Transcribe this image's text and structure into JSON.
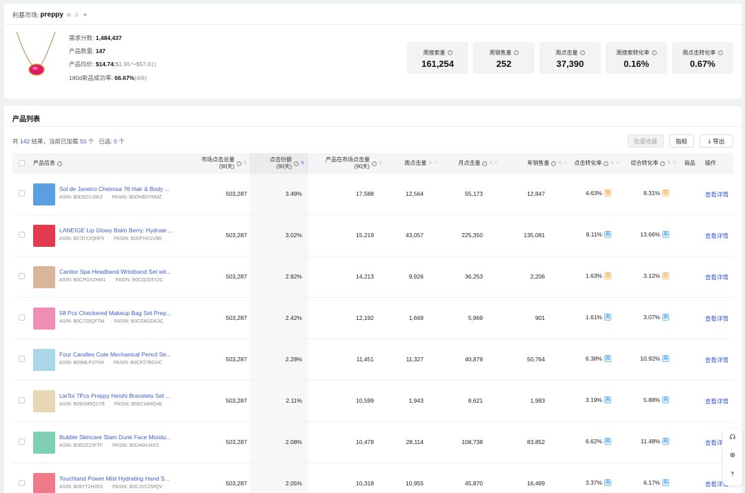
{
  "market": {
    "label": "利基市场:",
    "keyword": "preppy",
    "copy_icon": "copy-icon",
    "share_icon": "person-icon",
    "star_icon": "star-icon"
  },
  "overview": {
    "demand_label": "需求分数:",
    "demand_value": "1,484,437",
    "count_label": "产品数量:",
    "count_value": "147",
    "price_label": "产品均价:",
    "price_value": "$14.74",
    "price_range": "($1.95～$57.61)",
    "success_label": "180d新品成功率:",
    "success_value": "66.67%",
    "success_frac": "(4/6)"
  },
  "stats": [
    {
      "label": "周搜索量",
      "value": "161,254"
    },
    {
      "label": "周销售量",
      "value": "252"
    },
    {
      "label": "周点击量",
      "value": "37,390"
    },
    {
      "label": "周搜索转化率",
      "value": "0.16%"
    },
    {
      "label": "周点击转化率",
      "value": "0.67%"
    }
  ],
  "list": {
    "title": "产品列表",
    "summary_pre": "共",
    "total": "142",
    "summary_mid": "结果，当前已加载",
    "loaded": "50",
    "summary_unit": "个",
    "selected_label": "已选:",
    "selected": "0",
    "batch_label": "批量收藏",
    "metrics_label": "指标",
    "export_label": "导出"
  },
  "columns": {
    "info": "产品信息",
    "market_clicks": "市场点击总量",
    "market_clicks_sub": "(90天)",
    "click_share": "点击份额",
    "click_share_sub": "(90天)",
    "product_clicks": "产品在市场点击量",
    "product_clicks_sub": "(90天)",
    "weekly_clicks": "周点击量",
    "monthly_clicks": "月点击量",
    "annual_sales": "年销售量",
    "ctr": "点击转化率",
    "overall_cr": "综合转化率",
    "goods": "商品",
    "action": "操作"
  },
  "rows": [
    {
      "name": "Sol de Janeiro Cheirosa 76 Hair & Body ...",
      "asin": "ASIN: B0D6ZVJ3K2",
      "pasin": "PASIN: B0DH8DYNMZ",
      "market_clicks": "503,287",
      "share": "3.49%",
      "product_clicks": "17,588",
      "weekly": "12,564",
      "monthly": "55,173",
      "annual": "12,847",
      "ctr": "4.63%",
      "ctr_tag": "低",
      "ctr_level": "low",
      "cr": "8.31%",
      "cr_tag": "低",
      "cr_level": "low",
      "action": "查看详情",
      "thumb_color": "#5aa0e0"
    },
    {
      "name": "LANEIGE Lip Glowy Balm Berry: Hydrate ...",
      "asin": "ASIN: B07DY2QRF6",
      "pasin": "PASIN: B0DFHX1V9R",
      "market_clicks": "503,287",
      "share": "3.02%",
      "product_clicks": "15,219",
      "weekly": "43,057",
      "monthly": "225,350",
      "annual": "135,081",
      "ctr": "8.11%",
      "ctr_tag": "高",
      "ctr_level": "up",
      "cr": "13.66%",
      "cr_tag": "高",
      "cr_level": "up",
      "action": "查看详情",
      "thumb_color": "#e23a4e"
    },
    {
      "name": "Canitor Spa Headband Wristband Set wit...",
      "asin": "ASIN: B0CPDXZHM1",
      "pasin": "PASIN: B0CQ2D572C",
      "market_clicks": "503,287",
      "share": "2.82%",
      "product_clicks": "14,213",
      "weekly": "9,926",
      "monthly": "36,253",
      "annual": "2,206",
      "ctr": "1.63%",
      "ctr_tag": "低",
      "ctr_level": "low",
      "cr": "3.12%",
      "cr_tag": "低",
      "cr_level": "low",
      "action": "查看详情",
      "thumb_color": "#d9b59b"
    },
    {
      "name": "58 Pcs Checkered Makeup Bag Set Prep...",
      "asin": "ASIN: B0C729QFTM",
      "pasin": "PASIN: B0CGMJDK3C",
      "market_clicks": "503,287",
      "share": "2.42%",
      "product_clicks": "12,192",
      "weekly": "1,669",
      "monthly": "5,969",
      "annual": "901",
      "ctr": "1.61%",
      "ctr_tag": "高",
      "ctr_level": "up",
      "cr": "3.07%",
      "cr_tag": "高",
      "cr_level": "up",
      "action": "查看详情",
      "thumb_color": "#f08fb5"
    },
    {
      "name": "Four Candles Cute Mechanical Pencil Se...",
      "asin": "ASIN: B09MLP27XH",
      "pasin": "PASIN: B0CP27BCHC",
      "market_clicks": "503,287",
      "share": "2.28%",
      "product_clicks": "11,451",
      "weekly": "11,327",
      "monthly": "40,879",
      "annual": "50,764",
      "ctr": "6.38%",
      "ctr_tag": "高",
      "ctr_level": "up",
      "cr": "10.92%",
      "cr_tag": "高",
      "cr_level": "up",
      "action": "查看详情",
      "thumb_color": "#a9d6e8"
    },
    {
      "name": "LieToi 7Pcs Preppy Heishi Bracelets Set ...",
      "asin": "ASIN: B09XM9Q1YB",
      "pasin": "PASIN: B0B214MQ48",
      "market_clicks": "503,287",
      "share": "2.11%",
      "product_clicks": "10,599",
      "weekly": "1,943",
      "monthly": "8,621",
      "annual": "1,983",
      "ctr": "3.19%",
      "ctr_tag": "高",
      "ctr_level": "up",
      "cr": "5.88%",
      "cr_tag": "高",
      "cr_level": "up",
      "action": "查看详情",
      "thumb_color": "#e8d7b5"
    },
    {
      "name": "Bubble Skincare Slam Dunk Face Moistu...",
      "asin": "ASIN: B0BSZ23FTF",
      "pasin": "PASIN: B0D46HJ4XS",
      "market_clicks": "503,287",
      "share": "2.08%",
      "product_clicks": "10,478",
      "weekly": "28,114",
      "monthly": "108,738",
      "annual": "83,852",
      "ctr": "6.62%",
      "ctr_tag": "高",
      "ctr_level": "up",
      "cr": "11.48%",
      "cr_tag": "高",
      "cr_level": "up",
      "action": "查看详情",
      "thumb_color": "#7fcfb5"
    },
    {
      "name": "Touchland Power Mist Hydrating Hand S...",
      "asin": "ASIN: B09YT2H35S",
      "pasin": "PASIN: B0CJVCZWQV",
      "market_clicks": "503,287",
      "share": "2.05%",
      "product_clicks": "10,318",
      "weekly": "10,955",
      "monthly": "45,870",
      "annual": "16,499",
      "ctr": "3.37%",
      "ctr_tag": "高",
      "ctr_level": "up",
      "cr": "6.17%",
      "cr_tag": "高",
      "cr_level": "up",
      "action": "查看详情",
      "thumb_color": "#f07a8a"
    }
  ],
  "float_tools": [
    "headset-icon",
    "globe-icon",
    "back-to-top-icon"
  ],
  "colors": {
    "link": "#3b5bdb",
    "tag_up": "#1c7ed6",
    "tag_low": "#f08c00"
  }
}
